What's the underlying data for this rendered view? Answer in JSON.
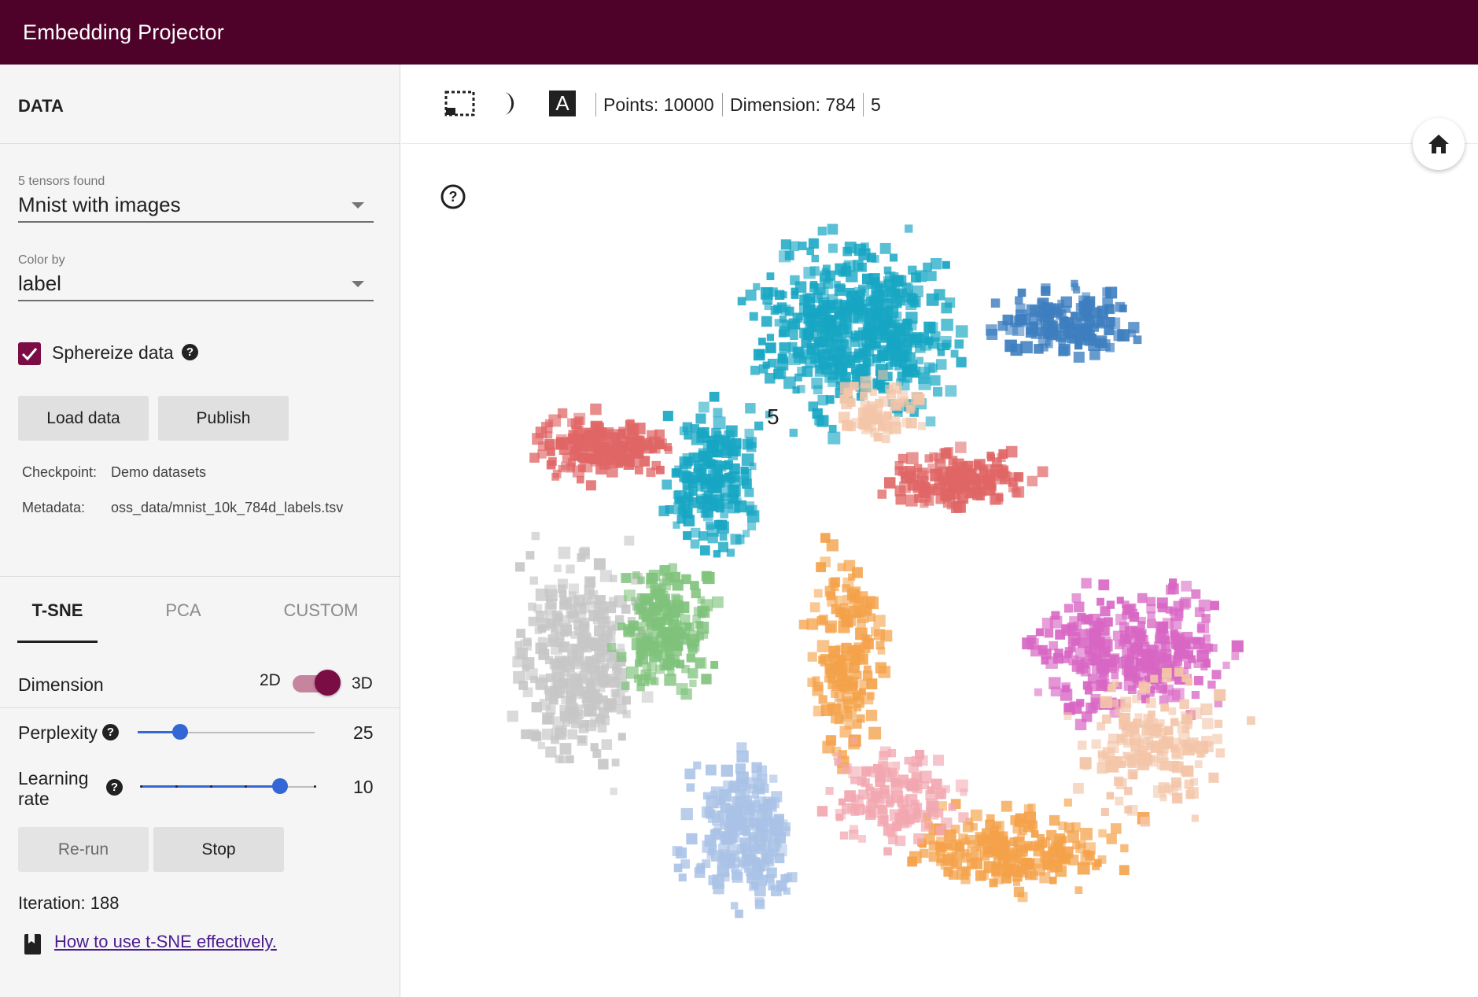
{
  "app": {
    "title": "Embedding Projector"
  },
  "sidebar": {
    "section_title": "DATA",
    "tensors": {
      "label": "5 tensors found",
      "value": "Mnist with images"
    },
    "color_by": {
      "label": "Color by",
      "value": "label"
    },
    "sphereize": {
      "label": "Sphereize data",
      "checked": true,
      "help": "?"
    },
    "buttons": {
      "load": "Load data",
      "publish": "Publish"
    },
    "checkpoint": {
      "key": "Checkpoint:",
      "value": "Demo datasets"
    },
    "metadata": {
      "key": "Metadata:",
      "value": "oss_data/mnist_10k_784d_labels.tsv"
    },
    "tabs": [
      {
        "label": "T-SNE",
        "active": true
      },
      {
        "label": "PCA",
        "active": false
      },
      {
        "label": "CUSTOM",
        "active": false
      }
    ],
    "dimension": {
      "label": "Dimension",
      "left": "2D",
      "right": "3D",
      "value": "3D"
    },
    "perplexity": {
      "label": "Perplexity",
      "help": "?",
      "value": "25",
      "fraction": 0.24
    },
    "learning_rate": {
      "label_line1": "Learning",
      "label_line2": "rate",
      "help": "?",
      "value": "10",
      "fraction": 0.8
    },
    "run_buttons": {
      "rerun": "Re-run",
      "stop": "Stop"
    },
    "iteration": "Iteration: 188",
    "link": "How to use t-SNE effectively."
  },
  "toolbar": {
    "icons": [
      "selection-box-icon",
      "night-mode-icon",
      "label-toggle-icon"
    ],
    "label_icon_text": "A",
    "points": "Points: 10000",
    "dimension": "Dimension: 784",
    "selected": "5"
  },
  "viewport": {
    "home_icon": "home-icon",
    "help_icon": "help-circle-icon",
    "highlight_label": "5",
    "cluster_colors": {
      "0": "#3d7ebf",
      "1": "#f4a24a",
      "2": "#e06565",
      "3": "#f3c5a8",
      "4": "#d866c4",
      "5": "#c7c7c7",
      "6": "#17a6c3",
      "7": "#a9c2e6",
      "8": "#7fc27b",
      "9": "#f2a7b0"
    }
  }
}
